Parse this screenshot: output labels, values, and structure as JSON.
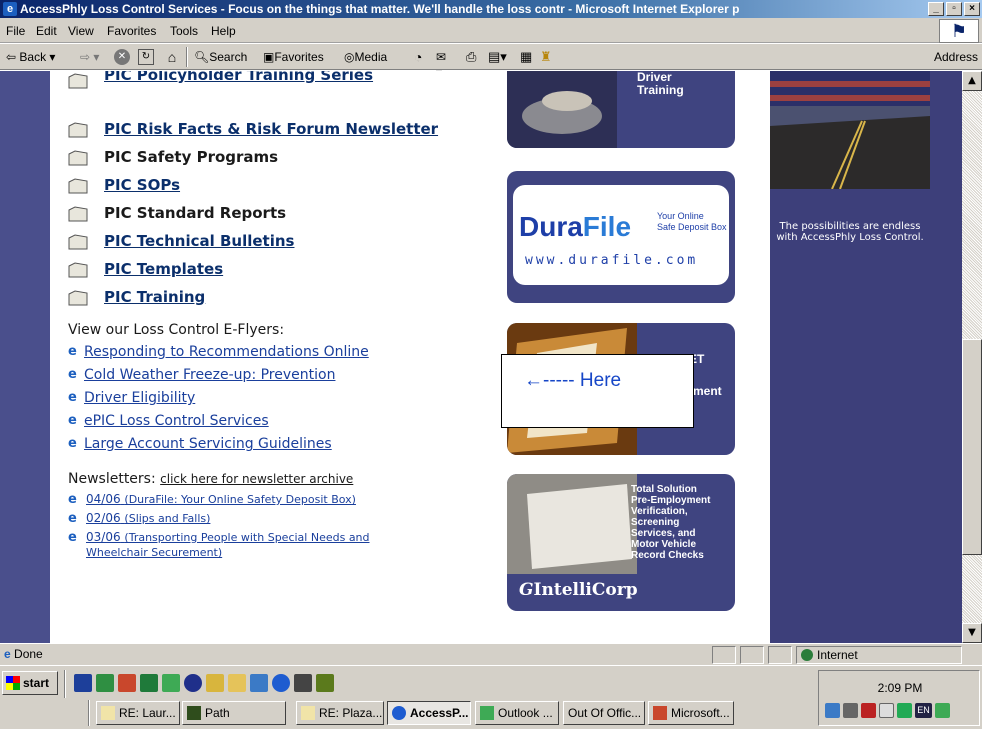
{
  "window": {
    "title": "AccessPhly Loss Control Services - Focus on the things that matter. We'll handle the loss contr - Microsoft Internet Explorer p"
  },
  "menu": {
    "items": [
      "File",
      "Edit",
      "View",
      "Favorites",
      "Tools",
      "Help"
    ]
  },
  "toolbar": {
    "back": "Back",
    "search": "Search",
    "favorites": "Favorites",
    "media": "Media",
    "address": "Address"
  },
  "page": {
    "pic_links": [
      "PIC Policyholder Training Series",
      "PIC Risk Facts & Risk Forum Newsletter",
      "PIC Safety Programs",
      "PIC SOPs",
      "PIC Standard Reports",
      "PIC Technical Bulletins",
      "PIC Templates",
      "PIC Training"
    ],
    "eflyers_heading": "View our Loss Control E-Flyers:",
    "eflyers": [
      "Responding to Recommendations Online",
      "Cold Weather Freeze-up: Prevention",
      "Driver Eligibility",
      "ePIC Loss Control Services",
      "Large Account Servicing Guidelines"
    ],
    "newsletters_heading": "Newsletters:",
    "newsletters_archive": "click here for newsletter archive",
    "newsletters": [
      {
        "date": "04/06",
        "desc": "(DuraFile: Your Online Safety Deposit Box)"
      },
      {
        "date": "02/06",
        "desc": "(Slips and Falls)"
      },
      {
        "date": "03/06",
        "desc": "(Transporting People with Special Needs and"
      },
      {
        "date": "",
        "desc": "Wheelchair Securement)"
      }
    ],
    "ads": {
      "driver_training_l1": "Driver",
      "driver_training_l2": "Training",
      "durafile_brand1": "Dura",
      "durafile_brand2": "File",
      "durafile_tag1": "Your Online",
      "durafile_tag2": "Safe Deposit Box",
      "durafile_url": "www.durafile.com",
      "third_a": "ET",
      "third_b": "ment",
      "intellicorp_lines": [
        "Total Solution",
        "Pre-Employment",
        "Verification,",
        "Screening",
        "Services, and",
        "Motor Vehicle",
        "Record Checks"
      ],
      "intellicorp_brand": "IntelliCorp"
    },
    "here_callout": "←----- Here",
    "side_text": "The possibilities are endless with AccessPhly Loss Control."
  },
  "status": {
    "left": "Done",
    "zone": "Internet"
  },
  "taskbar": {
    "start": "start",
    "clock": "2:09 PM",
    "buttons": [
      "RE: Laur...",
      "Path",
      "RE: Plaza...",
      "AccessP...",
      "Outlook ...",
      "Out Of Offic...",
      "Microsoft..."
    ],
    "tray_lang": "EN"
  },
  "colors": {
    "link": "#1a3f9c",
    "pic_link": "#0b2f6b",
    "navy_panel": "#3d3f7a",
    "title_gradient_start": "#0a246a",
    "here_text": "#1646c7"
  }
}
